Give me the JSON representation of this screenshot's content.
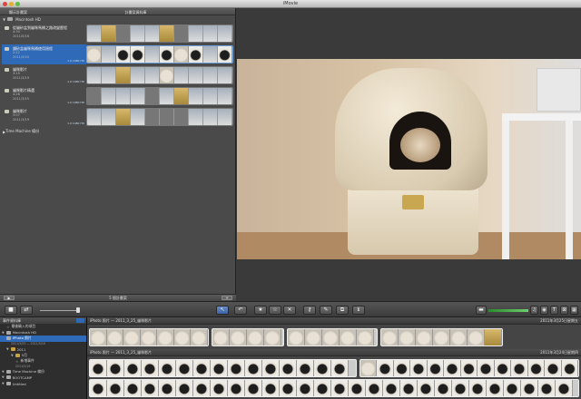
{
  "window": {
    "title": "iMovie"
  },
  "project_library": {
    "back_button": "顯示計畫案",
    "header": "計畫案資料庫",
    "disk": "Macintosh HD",
    "projects": [
      {
        "title": "從貓砂盆到貓咪馬桶之路改變歷程",
        "duration": "4:34",
        "date": "2011/5/16",
        "badge": "",
        "selected": false
      },
      {
        "title": "鋪砂盆貓咪馬桶使用過程",
        "duration": "2:12",
        "date": "2011/5/20",
        "badge": "1.0 1080 HD",
        "selected": true
      },
      {
        "title": "貓咪影片",
        "duration": "3:15",
        "date": "2011/3/19",
        "badge": "1.0 1080 HD",
        "selected": false
      },
      {
        "title": "貓咪影片精選",
        "duration": "4:26",
        "date": "2011/3/15",
        "badge": "1.0 1080 HD",
        "selected": false
      },
      {
        "title": "貓咪影片",
        "duration": "3:07",
        "date": "2011/3/19",
        "badge": "1.0 1080 HD",
        "selected": false
      }
    ],
    "time_machine": "Time Machine 備份",
    "footer": "5 個計畫案"
  },
  "toolbar": {
    "buttons": [
      {
        "name": "camera-import-button",
        "glyph": "■"
      },
      {
        "name": "swap-viewer-button",
        "glyph": "⇄"
      },
      {
        "name": "select-tool-button",
        "glyph": "↖"
      },
      {
        "name": "undo-button",
        "glyph": "↶"
      },
      {
        "name": "favorite-button",
        "glyph": "★"
      },
      {
        "name": "unmark-button",
        "glyph": "☆"
      },
      {
        "name": "reject-button",
        "glyph": "✕"
      },
      {
        "name": "keyword-button",
        "glyph": "⚷"
      },
      {
        "name": "voiceover-button",
        "glyph": "✎"
      },
      {
        "name": "crop-button",
        "glyph": "⧉"
      },
      {
        "name": "inspector-button",
        "glyph": "ℹ"
      }
    ],
    "right_buttons": [
      {
        "name": "music-browser-button",
        "glyph": "♫"
      },
      {
        "name": "photo-browser-button",
        "glyph": "◉"
      },
      {
        "name": "title-browser-button",
        "glyph": "T"
      },
      {
        "name": "transition-browser-button",
        "glyph": "⊠"
      },
      {
        "name": "map-browser-button",
        "glyph": "▦"
      }
    ]
  },
  "event_library": {
    "header": "事件資料庫",
    "items": [
      {
        "label": "最後輸入的項目",
        "icon": "star",
        "indent": 1,
        "selected": false
      },
      {
        "label": "Macintosh HD",
        "icon": "disk",
        "indent": 0,
        "selected": false
      },
      {
        "label": "iPhoto 照片",
        "icon": "photo",
        "indent": 1,
        "selected": true
      },
      {
        "label": "2011/3/25 — 2011/5/16",
        "icon": "",
        "indent": 2,
        "selected": false
      },
      {
        "label": "2011",
        "icon": "folder",
        "indent": 1,
        "selected": false
      },
      {
        "label": "5月",
        "icon": "folder",
        "indent": 2,
        "selected": false
      },
      {
        "label": "新增事件",
        "icon": "star",
        "indent": 3,
        "selected": false
      },
      {
        "label": "2011/5/16",
        "icon": "",
        "indent": 3,
        "selected": false
      },
      {
        "label": "Time Machine 備份",
        "icon": "disk",
        "indent": 0,
        "selected": false
      },
      {
        "label": "BOOTCAMP",
        "icon": "disk",
        "indent": 0,
        "selected": false
      },
      {
        "label": "Untitled",
        "icon": "disk",
        "indent": 0,
        "selected": false
      }
    ]
  },
  "event_browser": {
    "groups": [
      {
        "title": "iPhoto 照片 — 2011_3_25_貓咪影片",
        "date": "2011年3月25日星期五"
      },
      {
        "title": "iPhoto 照片 — 2011_3_25_貓咪影片",
        "date": "2011年3月24日星期四"
      }
    ]
  }
}
